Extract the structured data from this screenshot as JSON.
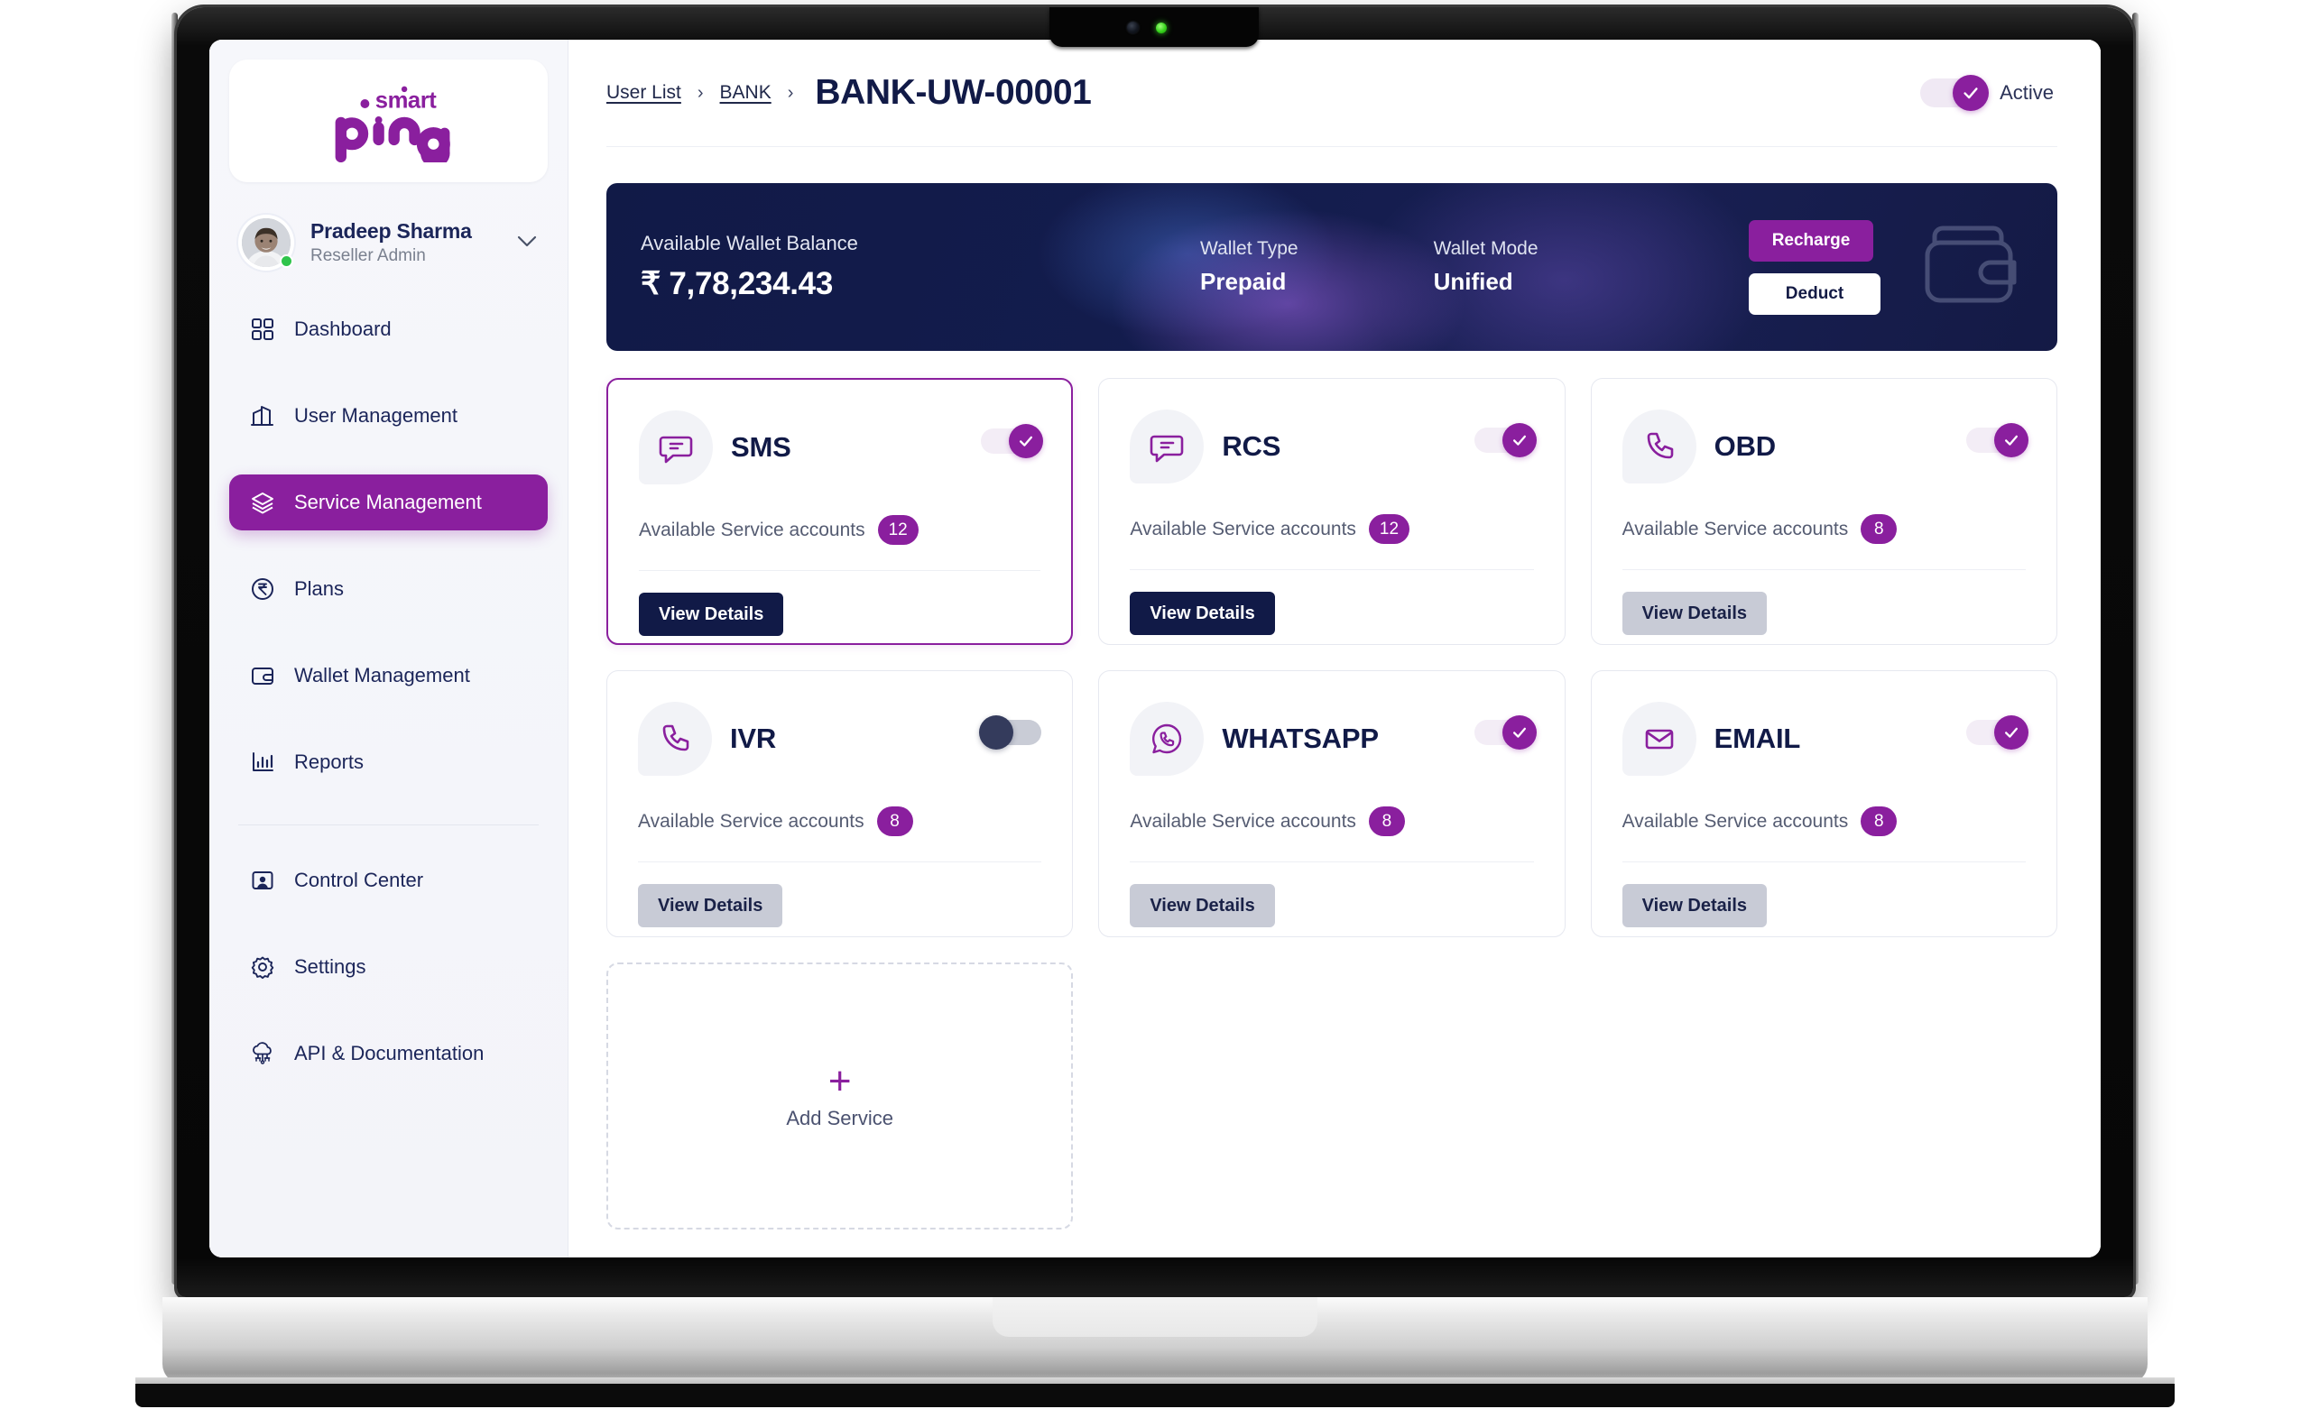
{
  "brand": {
    "logo_text_top": "smart",
    "logo_text_main": "ping"
  },
  "profile": {
    "name": "Pradeep Sharma",
    "role": "Reseller Admin",
    "chevron": "chevron-down-icon",
    "status": "online"
  },
  "sidebar": {
    "items": [
      {
        "label": "Dashboard",
        "icon": "grid-icon",
        "active": false
      },
      {
        "label": "User Management",
        "icon": "building-icon",
        "active": false
      },
      {
        "label": "Service Management",
        "icon": "layers-icon",
        "active": true
      },
      {
        "label": "Plans",
        "icon": "rupee-circle-icon",
        "active": false
      },
      {
        "label": "Wallet Management",
        "icon": "wallet-icon",
        "active": false
      },
      {
        "label": "Reports",
        "icon": "bar-chart-icon",
        "active": false
      },
      {
        "label": "Control Center",
        "icon": "user-screen-icon",
        "active": false
      },
      {
        "label": "Settings",
        "icon": "gear-icon",
        "active": false
      },
      {
        "label": "API & Documentation",
        "icon": "cloud-chip-icon",
        "active": false
      }
    ]
  },
  "header": {
    "breadcrumb": [
      "User List",
      "BANK"
    ],
    "separator": "›",
    "title": "BANK-UW-00001",
    "status_toggle": {
      "label": "Active",
      "on": true
    }
  },
  "wallet": {
    "balance_caption": "Available Wallet Balance",
    "balance_value": "₹ 7,78,234.43",
    "type_caption": "Wallet Type",
    "type_value": "Prepaid",
    "mode_caption": "Wallet Mode",
    "mode_value": "Unified",
    "recharge_label": "Recharge",
    "deduct_label": "Deduct",
    "icon": "wallet-outline-icon"
  },
  "services": {
    "accounts_label": "Available Service accounts",
    "details_label": "View Details",
    "cards": [
      {
        "name": "SMS",
        "icon": "chat-bubble-icon",
        "accounts": "12",
        "enabled": true,
        "selected": true,
        "details_enabled": true
      },
      {
        "name": "RCS",
        "icon": "chat-bubble-icon",
        "accounts": "12",
        "enabled": true,
        "selected": false,
        "details_enabled": true
      },
      {
        "name": "OBD",
        "icon": "phone-icon",
        "accounts": "8",
        "enabled": true,
        "selected": false,
        "details_enabled": false
      },
      {
        "name": "IVR",
        "icon": "phone-icon",
        "accounts": "8",
        "enabled": false,
        "selected": false,
        "details_enabled": false
      },
      {
        "name": "WHATSAPP",
        "icon": "whatsapp-icon",
        "accounts": "8",
        "enabled": true,
        "selected": false,
        "details_enabled": false
      },
      {
        "name": "EMAIL",
        "icon": "envelope-icon",
        "accounts": "8",
        "enabled": true,
        "selected": false,
        "details_enabled": false
      }
    ],
    "add_card": {
      "label": "Add Service",
      "icon": "plus-icon"
    }
  },
  "colors": {
    "brand_purple": "#8A1F9E",
    "navy": "#111A47",
    "sidebar_bg": "#F4F5FA",
    "muted_button": "#C8CBD6",
    "online_green": "#2FC44B"
  }
}
